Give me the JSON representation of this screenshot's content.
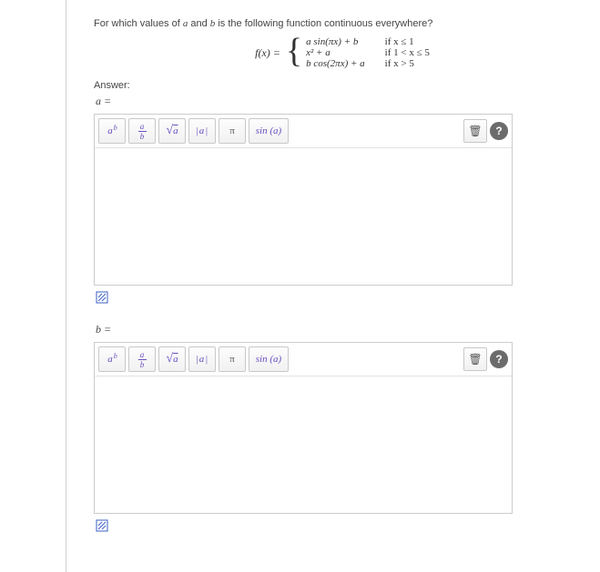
{
  "question": {
    "prefix": "For which values of ",
    "var_a": "a",
    "mid": " and ",
    "var_b": "b",
    "suffix": " is the following function continuous everywhere?"
  },
  "equation": {
    "lhs": "f(x) =",
    "cases": [
      {
        "expr": "a sin(πx) + b",
        "cond": "if x ≤ 1"
      },
      {
        "expr": "x² + a",
        "cond": "if 1 < x ≤ 5"
      },
      {
        "expr": "b cos(2πx) + a",
        "cond": "if x > 5"
      }
    ]
  },
  "answer_label": "Answer:",
  "parts": [
    {
      "var": "a ="
    },
    {
      "var": "b ="
    }
  ],
  "toolbar": {
    "power": "a",
    "power_sup": "b",
    "frac_top": "a",
    "frac_bot": "b",
    "sqrt": "a",
    "abs": "|a|",
    "pi": "π",
    "sin": "sin (a)",
    "trash": "🗑",
    "help": "?"
  }
}
